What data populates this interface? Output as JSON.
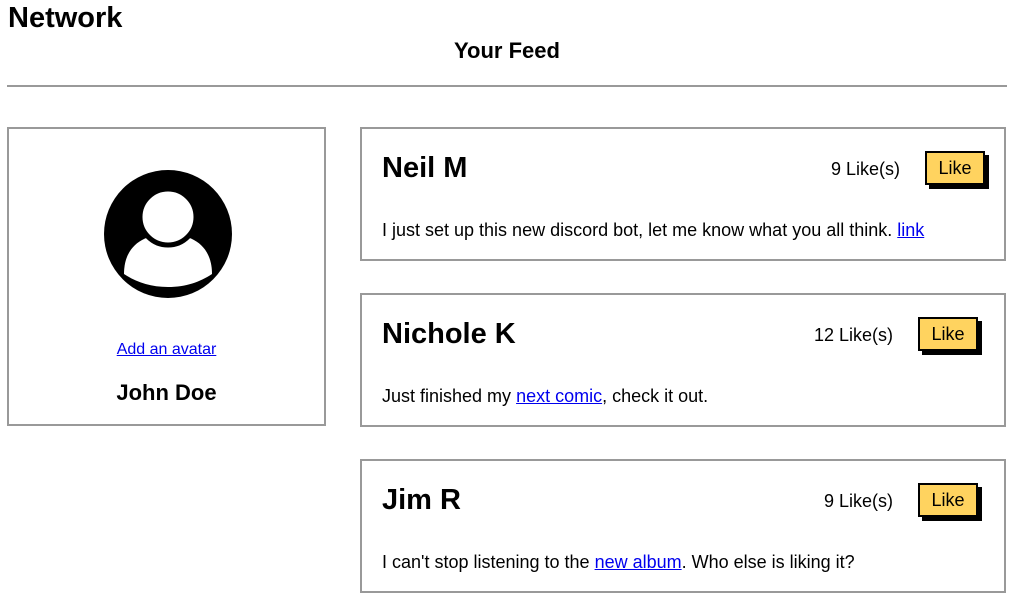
{
  "header": {
    "brand": "Network",
    "feed_title": "Your Feed"
  },
  "profile": {
    "avatar_icon": "user-avatar-icon",
    "add_avatar_link": "Add an avatar",
    "name": "John Doe"
  },
  "like_label": "Like",
  "posts": [
    {
      "author": "Neil M",
      "likes": "9 Like(s)",
      "text_before": "I just set up this new discord bot, let me know what you all think. ",
      "link_text": "link",
      "text_after": ""
    },
    {
      "author": "Nichole K",
      "likes": "12 Like(s)",
      "text_before": "Just finished my ",
      "link_text": "next comic",
      "text_after": ", check it out."
    },
    {
      "author": "Jim R",
      "likes": "9 Like(s)",
      "text_before": "I can't stop listening to the ",
      "link_text": "new album",
      "text_after": ". Who else is liking it?"
    }
  ],
  "colors": {
    "like_button": "#ffd35f",
    "link": "#0000ee",
    "border": "#999999"
  }
}
